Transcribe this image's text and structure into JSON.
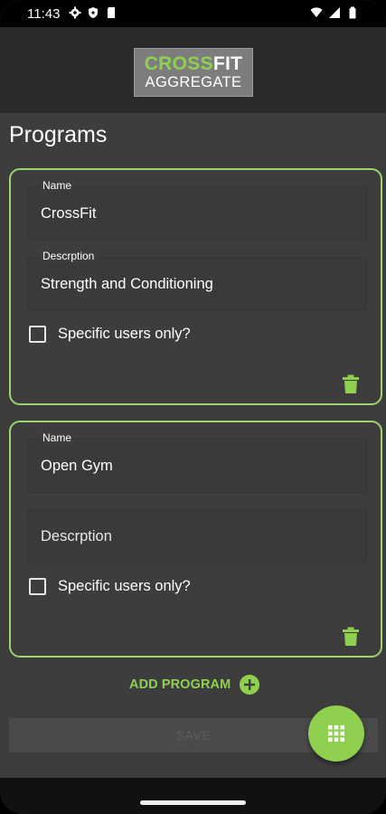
{
  "status_bar": {
    "time": "11:43",
    "left_icons": [
      "settings-icon",
      "shield-icon",
      "sd-card-icon"
    ],
    "right_icons": [
      "wifi-icon",
      "signal-icon",
      "battery-icon"
    ]
  },
  "header": {
    "logo_top_cross": "CROSS",
    "logo_top_fit": "FIT",
    "logo_bottom": "AGGREGATE"
  },
  "page": {
    "title": "Programs"
  },
  "programs": [
    {
      "name_label": "Name",
      "name_value": "CrossFit",
      "desc_label": "Descrption",
      "desc_value": "Strength and Conditioning",
      "specific_users_label": "Specific users only?",
      "specific_users_checked": false
    },
    {
      "name_label": "Name",
      "name_value": "Open Gym",
      "desc_placeholder": "Descrption",
      "specific_users_label": "Specific users only?",
      "specific_users_checked": false
    }
  ],
  "actions": {
    "add_program_label": "ADD PROGRAM",
    "save_label": "SAVE"
  },
  "colors": {
    "accent": "#8fd14f",
    "card_border": "#9bd66b",
    "background": "#3d3d3d",
    "header": "#2a2a2a"
  }
}
